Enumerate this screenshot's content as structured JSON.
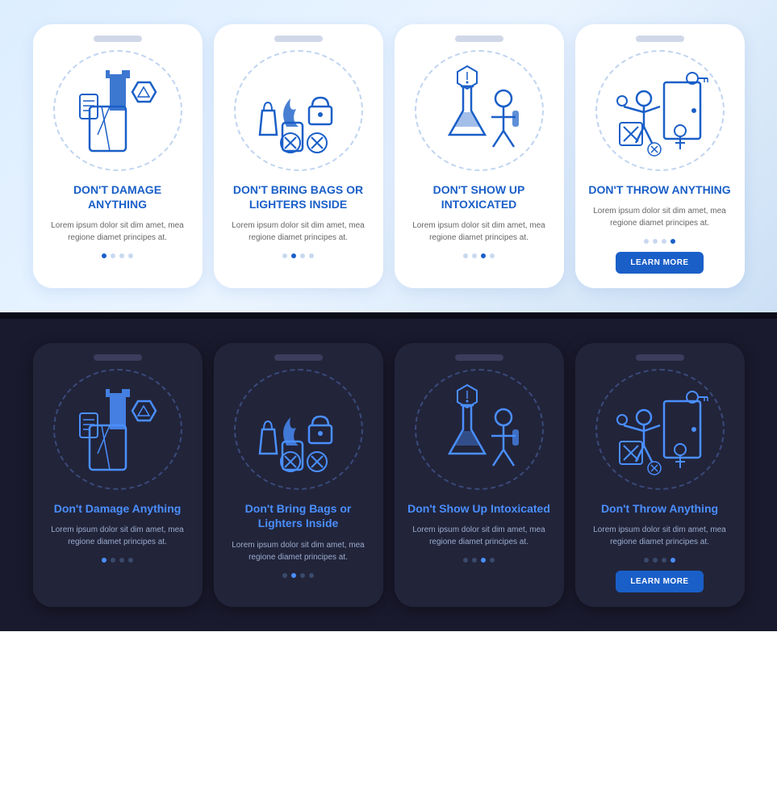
{
  "top": {
    "cards": [
      {
        "id": "damage",
        "title": "DON'T DAMAGE ANYTHING",
        "body": "Lorem ipsum dolor sit dim amet, mea regione diamet principes at.",
        "dots": [
          true,
          false,
          false,
          false
        ],
        "showButton": false
      },
      {
        "id": "bags",
        "title": "DON'T BRING BAGS OR LIGHTERS INSIDE",
        "body": "Lorem ipsum dolor sit dim amet, mea regione diamet principes at.",
        "dots": [
          false,
          true,
          false,
          false
        ],
        "showButton": false
      },
      {
        "id": "intoxicated",
        "title": "DON'T SHOW UP INTOXICATED",
        "body": "Lorem ipsum dolor sit dim amet, mea regione diamet principes at.",
        "dots": [
          false,
          false,
          true,
          false
        ],
        "showButton": false
      },
      {
        "id": "throw",
        "title": "DON'T THROW ANYTHING",
        "body": "Lorem ipsum dolor sit dim amet, mea regione diamet principes at.",
        "dots": [
          false,
          false,
          false,
          true
        ],
        "showButton": true,
        "buttonLabel": "LEARN MORE"
      }
    ]
  },
  "bottom": {
    "cards": [
      {
        "id": "damage-dark",
        "title": "Don't Damage Anything",
        "body": "Lorem ipsum dolor sit dim amet, mea regione diamet principes at.",
        "dots": [
          true,
          false,
          false,
          false
        ],
        "showButton": false
      },
      {
        "id": "bags-dark",
        "title": "Don't Bring Bags or Lighters Inside",
        "body": "Lorem ipsum dolor sit dim amet, mea regione diamet principes at.",
        "dots": [
          false,
          true,
          false,
          false
        ],
        "showButton": false
      },
      {
        "id": "intoxicated-dark",
        "title": "Don't Show Up Intoxicated",
        "body": "Lorem ipsum dolor sit dim amet, mea regione diamet principes at.",
        "dots": [
          false,
          false,
          true,
          false
        ],
        "showButton": false
      },
      {
        "id": "throw-dark",
        "title": "Don't Throw Anything",
        "body": "Lorem ipsum dolor sit dim amet, mea regione diamet principes at.",
        "dots": [
          false,
          false,
          false,
          true
        ],
        "showButton": true,
        "buttonLabel": "LEARN MORE"
      }
    ]
  },
  "colors": {
    "light_accent": "#1a5fc8",
    "dark_accent": "#4a8fff"
  }
}
